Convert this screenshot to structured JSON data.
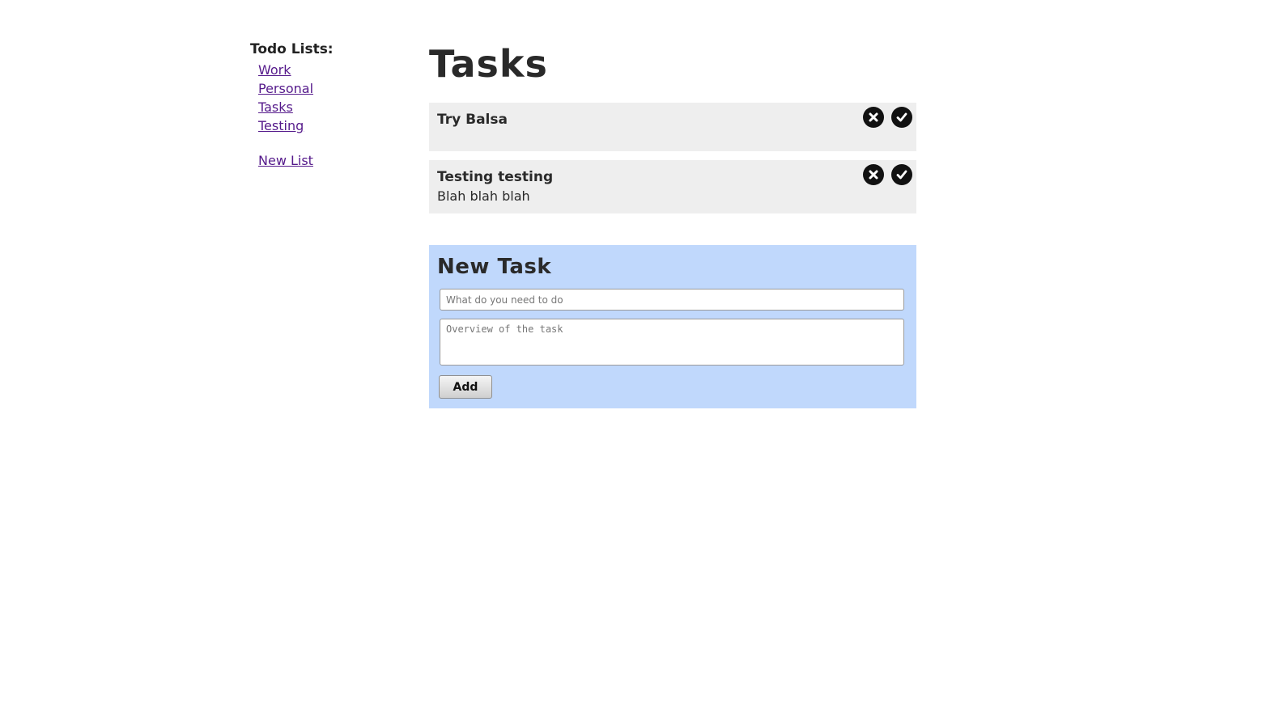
{
  "sidebar": {
    "heading": "Todo Lists:",
    "items": [
      {
        "label": "Work"
      },
      {
        "label": "Personal"
      },
      {
        "label": "Tasks"
      },
      {
        "label": "Testing"
      }
    ],
    "new_list_label": "New List"
  },
  "main": {
    "title": "Tasks",
    "tasks": [
      {
        "title": "Try Balsa",
        "description": ""
      },
      {
        "title": "Testing testing",
        "description": "Blah blah blah"
      }
    ],
    "new_task": {
      "title": "New Task",
      "name_placeholder": "What do you need to do",
      "description_placeholder": "Overview of the task",
      "add_label": "Add"
    }
  },
  "icons": {
    "delete": "circle-x-icon",
    "complete": "circle-check-icon"
  },
  "colors": {
    "link": "#551a8b",
    "task_background": "#eeeeee",
    "form_background": "#c0d8fc"
  }
}
